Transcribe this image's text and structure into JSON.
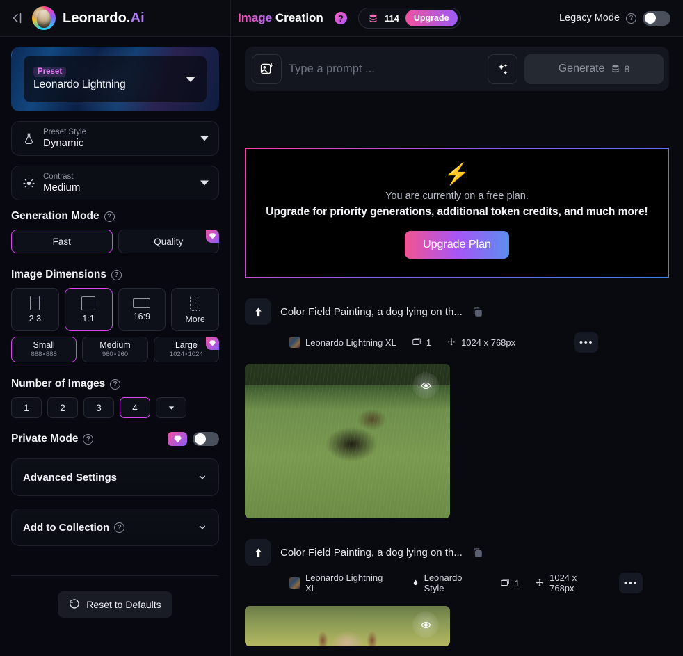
{
  "topbar": {
    "collapse_icon": "collapse-left-icon",
    "brand_name": "Leonardo.",
    "brand_suffix": "Ai",
    "page_title_highlight": "Image",
    "page_title_rest": " Creation",
    "help_badge": "?",
    "token_count": "114",
    "upgrade_label": "Upgrade",
    "legacy_mode_label": "Legacy Mode",
    "legacy_help": "?",
    "legacy_toggle_state": "off"
  },
  "sidebar": {
    "preset": {
      "tag": "Preset",
      "value": "Leonardo Lightning"
    },
    "preset_style": {
      "label": "Preset Style",
      "value": "Dynamic",
      "icon": "flask-icon"
    },
    "contrast": {
      "label": "Contrast",
      "value": "Medium",
      "icon": "brightness-icon"
    },
    "generation_mode": {
      "title": "Generation Mode",
      "help": "?",
      "options": [
        {
          "label": "Fast",
          "active": true,
          "premium": false
        },
        {
          "label": "Quality",
          "active": false,
          "premium": true
        }
      ]
    },
    "image_dimensions": {
      "title": "Image Dimensions",
      "help": "?",
      "ratios": [
        {
          "label": "2:3",
          "active": false
        },
        {
          "label": "1:1",
          "active": true
        },
        {
          "label": "16:9",
          "active": false
        },
        {
          "label": "More",
          "active": false
        }
      ],
      "sizes": [
        {
          "name": "Small",
          "dims": "888×888",
          "active": true,
          "premium": false
        },
        {
          "name": "Medium",
          "dims": "960×960",
          "active": false,
          "premium": false
        },
        {
          "name": "Large",
          "dims": "1024×1024",
          "active": false,
          "premium": true
        }
      ]
    },
    "number_of_images": {
      "title": "Number of Images",
      "help": "?",
      "options": [
        "1",
        "2",
        "3",
        "4"
      ],
      "active": "4",
      "more_icon": "chevron-down-icon"
    },
    "private_mode": {
      "title": "Private Mode",
      "help": "?",
      "premium_icon": "gem-icon",
      "toggle_state": "off"
    },
    "advanced_settings": {
      "title": "Advanced Settings",
      "chevron": "chevron-down-icon"
    },
    "add_to_collection": {
      "title": "Add to Collection",
      "help": "?",
      "chevron": "chevron-down-icon"
    },
    "reset_button": {
      "label": "Reset to Defaults",
      "icon": "reset-icon"
    }
  },
  "main": {
    "prompt": {
      "image_button_icon": "image-plus-icon",
      "placeholder": "Type a prompt ...",
      "value": "",
      "magic_icon": "sparkles-icon",
      "generate_label": "Generate",
      "generate_cost": "8",
      "coin_icon": "coins-icon"
    },
    "free_banner": {
      "bolt_icon": "⚡",
      "line1": "You are currently on a free plan.",
      "line2": "Upgrade for priority generations, additional token credits, and much more!",
      "button_label": "Upgrade Plan"
    },
    "generations": [
      {
        "prompt": "Color Field Painting, a dog lying on th...",
        "upload_icon": "arrow-up-icon",
        "copy_icon": "copy-icon",
        "model": "Leonardo Lightning XL",
        "style": null,
        "count": "1",
        "resolution": "1024 x 768px",
        "more_icon": "ellipsis-icon"
      },
      {
        "prompt": "Color Field Painting, a dog lying on th...",
        "upload_icon": "arrow-up-icon",
        "copy_icon": "copy-icon",
        "model": "Leonardo Lightning XL",
        "style": "Leonardo Style",
        "count": "1",
        "resolution": "1024 x 768px",
        "more_icon": "ellipsis-icon"
      }
    ],
    "preview_icon": "eye-icon"
  },
  "colors": {
    "accent_pink": "#d946ef",
    "accent_purple": "#8b5cf6",
    "background": "#090a0f",
    "panel": "#0c0e16",
    "border": "#1d202b"
  }
}
